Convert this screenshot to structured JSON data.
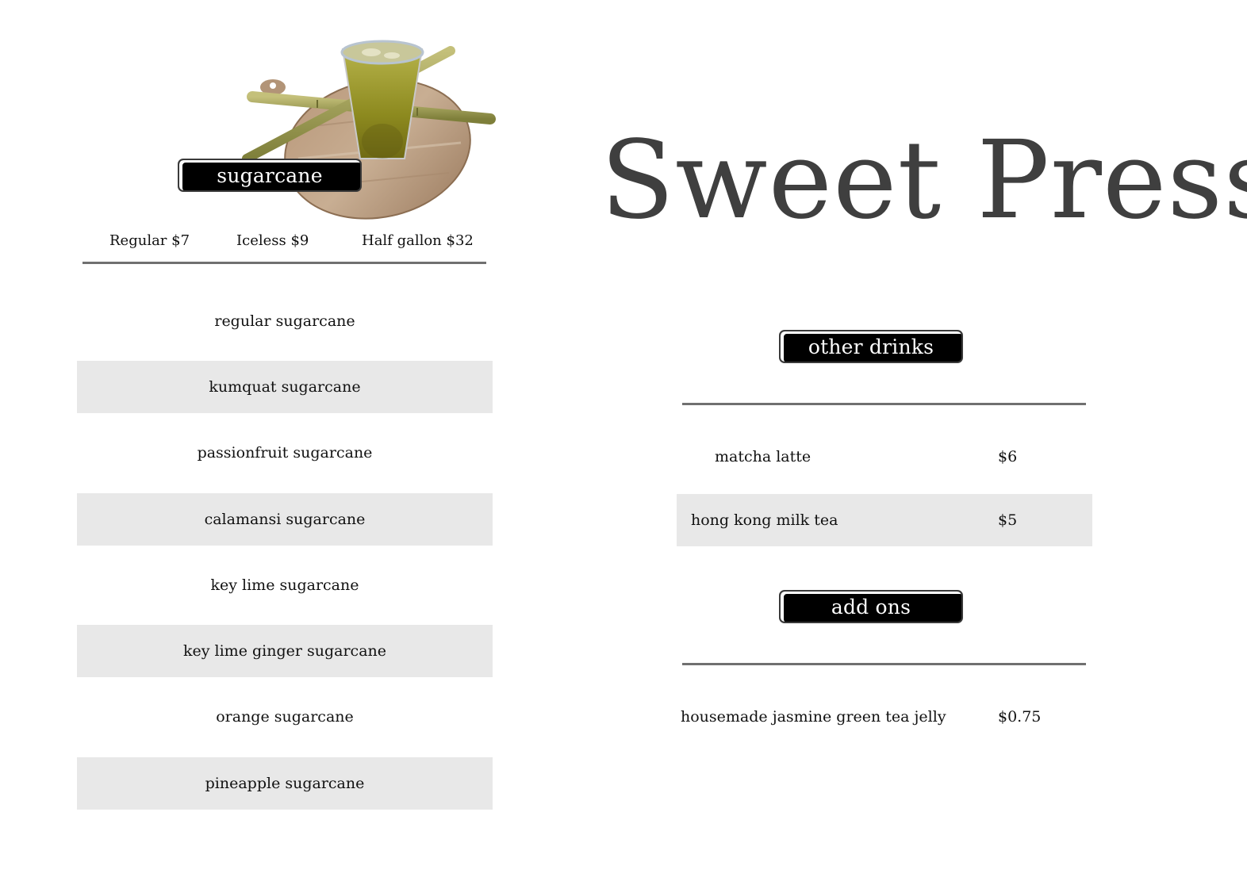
{
  "brand": {
    "title": "Sweet Press"
  },
  "sugarcane": {
    "section_label": "sugarcane",
    "photo": "sugarcane-drink-photo",
    "sizes": [
      {
        "label": "Regular $7"
      },
      {
        "label": "Iceless $9"
      },
      {
        "label": "Half gallon $32"
      }
    ],
    "flavors": [
      "regular sugarcane",
      "kumquat sugarcane",
      "passionfruit sugarcane",
      "calamansi sugarcane",
      "key lime sugarcane",
      "key lime ginger sugarcane",
      "orange sugarcane",
      "pineapple sugarcane"
    ]
  },
  "other_drinks": {
    "section_label": "other drinks",
    "items": [
      {
        "name": "matcha latte",
        "price": "$6"
      },
      {
        "name": "hong kong milk tea",
        "price": "$5"
      }
    ]
  },
  "add_ons": {
    "section_label": "add ons",
    "items": [
      {
        "name": "housemade jasmine green tea jelly",
        "price": "$0.75"
      }
    ]
  },
  "colors": {
    "pill_background": "#000000",
    "row_shade": "#e8e8e8",
    "divider": "#707070",
    "title": "#3f3f3f"
  }
}
